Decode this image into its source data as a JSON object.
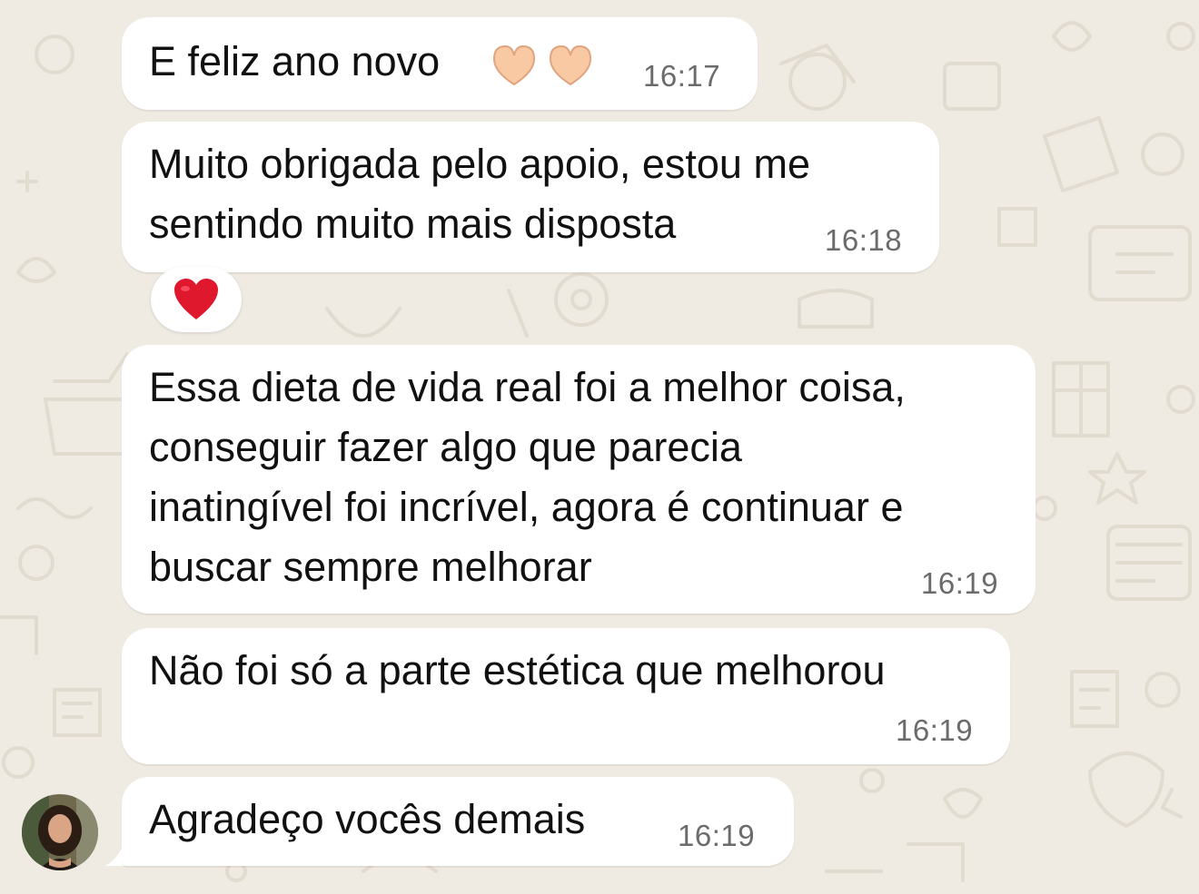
{
  "chat": {
    "messages": [
      {
        "text": "E feliz ano novo",
        "emoji": "heart-hands-emoji",
        "time": "16:17"
      },
      {
        "text": "Muito obrigada pelo apoio, estou me\nsentindo muito mais disposta",
        "time": "16:18",
        "reaction": "red-heart-emoji"
      },
      {
        "text": "Essa dieta de vida real foi a melhor coisa,\nconseguir fazer algo que parecia\ninatingível foi incrível, agora é continuar e\nbuscar sempre melhorar",
        "time": "16:19"
      },
      {
        "text": "Não foi só a parte estética que melhorou",
        "time": "16:19"
      },
      {
        "text": "Agradeço vocês demais",
        "time": "16:19"
      }
    ]
  },
  "colors": {
    "background": "#efeae2",
    "bubble": "#ffffff",
    "text": "#111111",
    "timestamp": "#6b6b6b",
    "heart": "#e0182d"
  }
}
